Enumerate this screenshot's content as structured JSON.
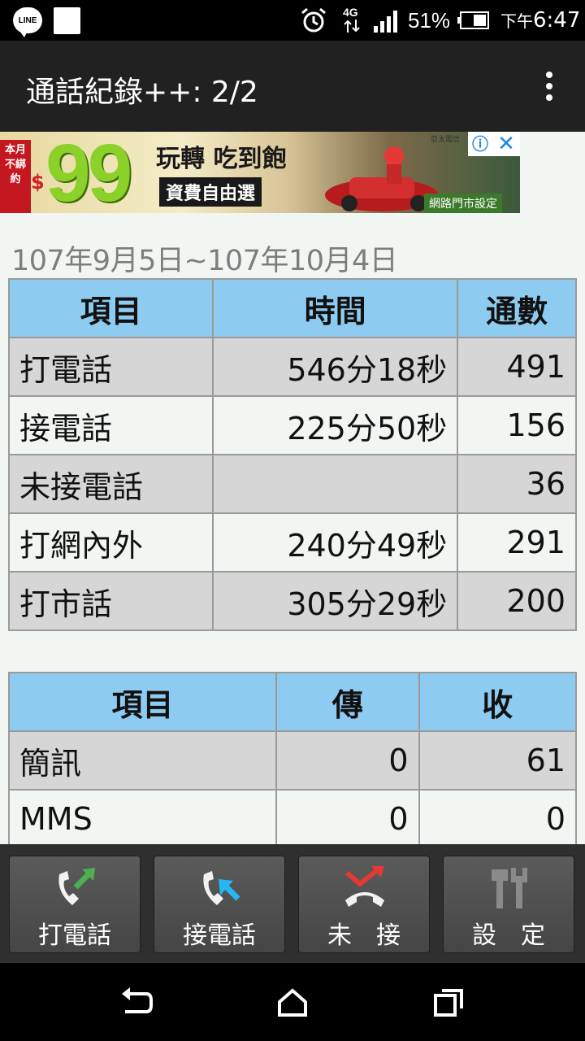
{
  "status_bar": {
    "network": "4G",
    "battery_percent": "51%",
    "time_ampm": "下午",
    "time": "6:47",
    "line_badge": "LINE"
  },
  "app_bar": {
    "title": "通話紀錄++: 2/2",
    "menu_icon": "overflow-menu-icon"
  },
  "ad": {
    "badge": "本月不綁約",
    "currency": "$",
    "price": "99",
    "headline": "玩轉 吃到飽",
    "tagline": "資費自由選",
    "brand": "亞太電信",
    "footer": "網路門市設定",
    "info_icon": "info-icon",
    "close_icon": "close-icon"
  },
  "date_range": "107年9月5日~107年10月4日",
  "call_table": {
    "headers": [
      "項目",
      "時間",
      "通數"
    ],
    "rows": [
      {
        "item": "打電話",
        "time": "546分18秒",
        "count": "491"
      },
      {
        "item": "接電話",
        "time": "225分50秒",
        "count": "156"
      },
      {
        "item": "未接電話",
        "time": "",
        "count": "36"
      },
      {
        "item": "打網內外",
        "time": "240分49秒",
        "count": "291"
      },
      {
        "item": "打市話",
        "time": "305分29秒",
        "count": "200"
      }
    ]
  },
  "msg_table": {
    "headers": [
      "項目",
      "傳",
      "收"
    ],
    "rows": [
      {
        "item": "簡訊",
        "sent": "0",
        "received": "61"
      },
      {
        "item": "MMS",
        "sent": "0",
        "received": "0"
      }
    ]
  },
  "toolbar": {
    "outgoing": "打電話",
    "incoming": "接電話",
    "missed": "未　接",
    "settings": "設　定"
  },
  "colors": {
    "header_bg": "#8ecbf0",
    "row_alt": "#d6d6d6",
    "row_plain": "#f2f6f2",
    "app_bar": "#212121",
    "toolbar": "#2f2f2f"
  }
}
